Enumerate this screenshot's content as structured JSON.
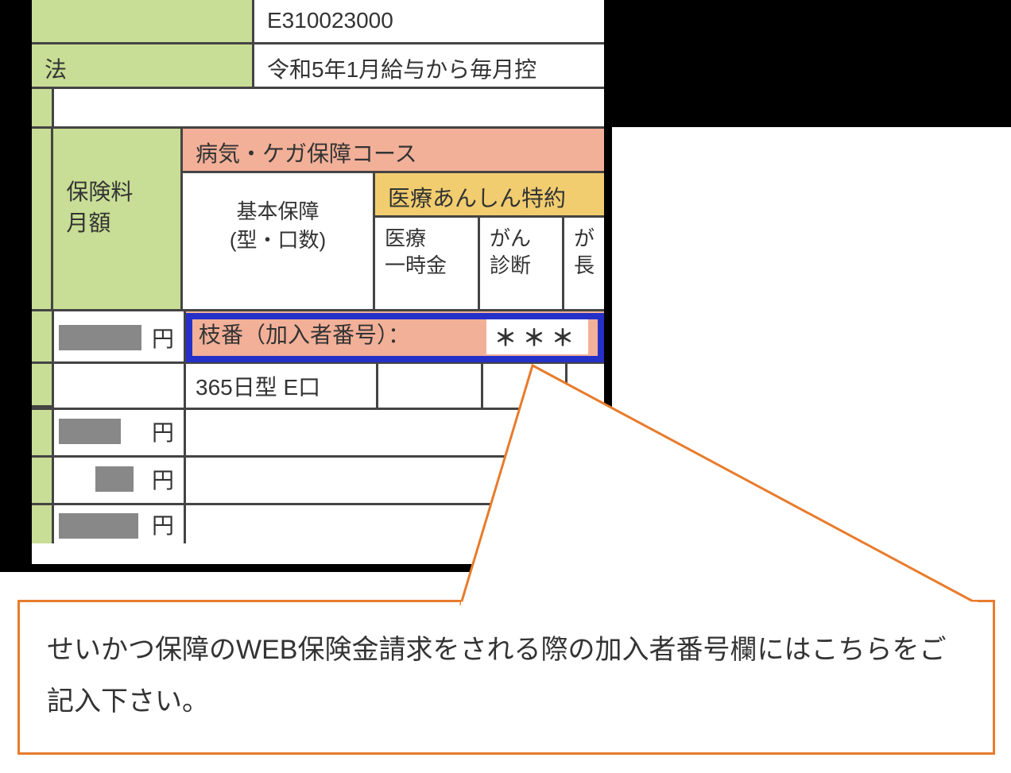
{
  "top": {
    "code": "E310023000",
    "method_label": "法",
    "method_value": "令和5年1月給与から毎月控"
  },
  "header": {
    "premium_label": "保険料\n月額",
    "course_title": "病気・ケガ保障コース",
    "basic_coverage": "基本保障\n(型・口数)",
    "special_title": "医療あんしん特約",
    "col_ichiji": "医療\n一時金",
    "col_gan": "がん\n診断",
    "col_last": "が\n長"
  },
  "enrollee": {
    "label": "枝番（加入者番号）：",
    "stars": "＊＊＊"
  },
  "data": {
    "type_365": "365日型 E口"
  },
  "yen": "円",
  "callout": "せいかつ保障のWEB保険金請求をされる際の加入者番号欄にはこちらをご記入下さい。"
}
